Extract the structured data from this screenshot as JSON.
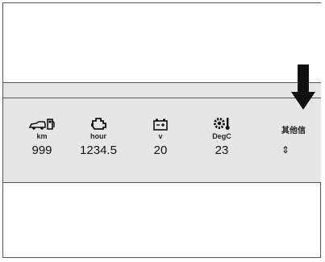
{
  "status_panel": {
    "items": [
      {
        "icon": "vehicle-fuel-icon",
        "unit": "km",
        "value": "999"
      },
      {
        "icon": "engine-icon",
        "unit": "hour",
        "value": "1234.5"
      },
      {
        "icon": "battery-icon",
        "unit": "v",
        "value": "20"
      },
      {
        "icon": "gear-temperature-icon",
        "unit": "DegC",
        "value": "23"
      }
    ],
    "other_info_label": "其他信",
    "scroll_indicator": "⇕"
  }
}
